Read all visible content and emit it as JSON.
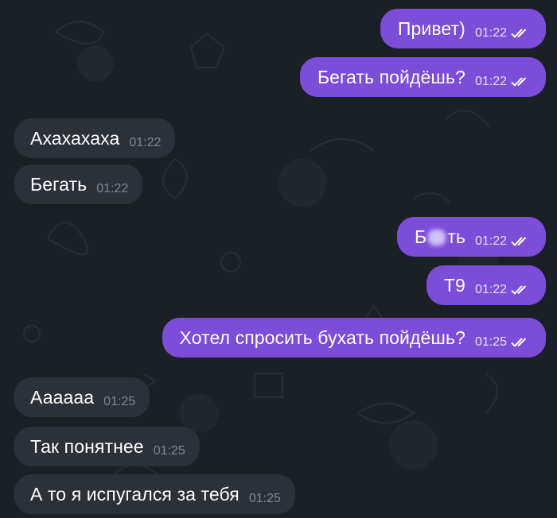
{
  "messages": [
    {
      "direction": "out",
      "text": "Привет)",
      "time": "01:22",
      "status": "read"
    },
    {
      "direction": "out",
      "text": "Бегать пойдёшь?",
      "time": "01:22",
      "status": "read"
    },
    {
      "direction": "in",
      "text": "Ахахахаха",
      "time": "01:22"
    },
    {
      "direction": "in",
      "text": "Бегать",
      "time": "01:22"
    },
    {
      "direction": "out",
      "text_before": "Б",
      "text_after": "ть",
      "time": "01:22",
      "status": "read",
      "redacted": true
    },
    {
      "direction": "out",
      "text": "Т9",
      "time": "01:22",
      "status": "read"
    },
    {
      "direction": "out",
      "text": "Хотел спросить бухать пойдёшь?",
      "time": "01:25",
      "status": "read"
    },
    {
      "direction": "in",
      "text": "Аааааа",
      "time": "01:25"
    },
    {
      "direction": "in",
      "text": "Так понятнее",
      "time": "01:25"
    },
    {
      "direction": "in",
      "text": "А то я испугался за тебя",
      "time": "01:25"
    }
  ],
  "colors": {
    "background": "#1b2027",
    "outgoing_bubble": "#7b4dd8",
    "incoming_bubble": "#2b3039",
    "incoming_time": "#7f8794"
  },
  "icons": {
    "read_receipt": "double-check-icon"
  }
}
